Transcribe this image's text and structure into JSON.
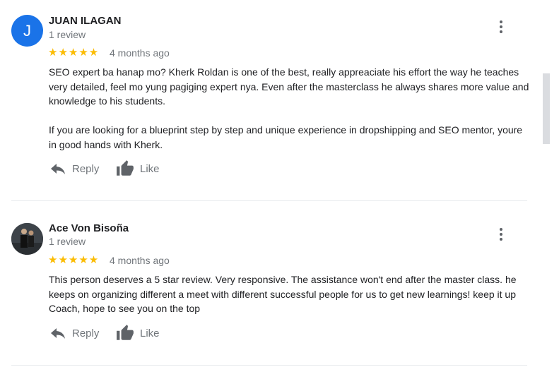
{
  "reviews": [
    {
      "author": "JUAN ILAGAN",
      "avatar_letter": "J",
      "review_count": "1 review",
      "rating": "★★★★★",
      "date": "4 months ago",
      "paragraphs": [
        "SEO expert ba hanap mo? Kherk Roldan is one of the best, really appreaciate his effort the way he teaches very detailed, feel mo yung pagiging expert nya. Even after the masterclass he always shares more value and knowledge to his students.",
        "If you are looking for a blueprint step by step and unique experience in dropshipping and SEO mentor, youre in good hands with Kherk."
      ],
      "reply_label": "Reply",
      "like_label": "Like"
    },
    {
      "author": "Ace Von Bisoña",
      "review_count": "1 review",
      "rating": "★★★★★",
      "date": "4 months ago",
      "paragraphs": [
        "This person deserves a 5 star review. Very responsive. The assistance won't end after the master class. he keeps on organizing different a meet with different successful people for us to get new learnings! keep it up Coach, hope to see you on the top"
      ],
      "reply_label": "Reply",
      "like_label": "Like"
    }
  ],
  "colors": {
    "star": "#fbbc04",
    "avatar_blue": "#1a73e8",
    "secondary_text": "#70757a",
    "icon_grey": "#5f6368"
  },
  "icons": [
    "more-vert-icon",
    "reply-icon",
    "thumb-up-icon"
  ]
}
